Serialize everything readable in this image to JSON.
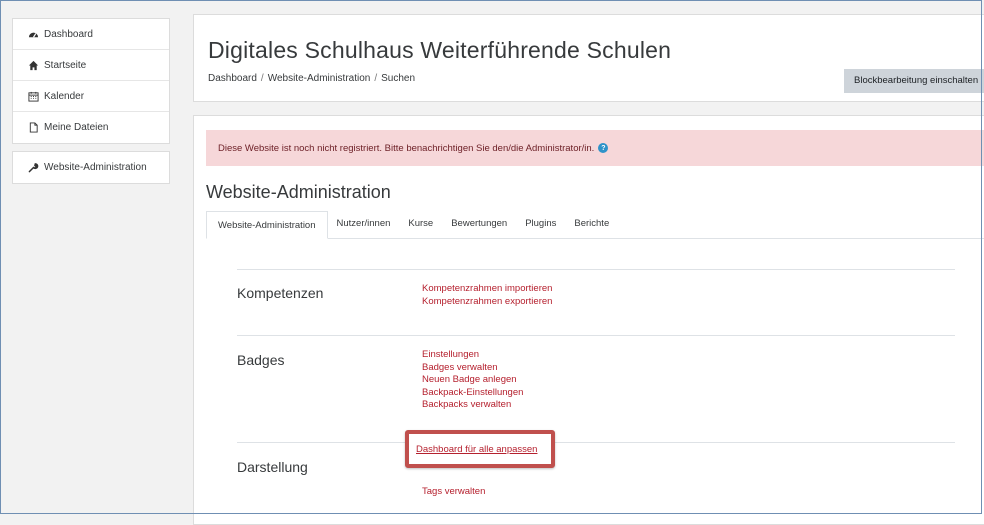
{
  "sidebar": {
    "items": [
      {
        "label": "Dashboard",
        "icon": "tachometer-icon"
      },
      {
        "label": "Startseite",
        "icon": "home-icon"
      },
      {
        "label": "Kalender",
        "icon": "calendar-icon"
      },
      {
        "label": "Meine Dateien",
        "icon": "file-icon"
      }
    ],
    "admin_item": {
      "label": "Website-Administration",
      "icon": "wrench-icon"
    }
  },
  "header": {
    "title": "Digitales Schulhaus Weiterführende Schulen",
    "breadcrumb": [
      "Dashboard",
      "Website-Administration",
      "Suchen"
    ],
    "breadcrumb_separator": "/",
    "edit_button": "Blockbearbeitung einschalten"
  },
  "alert": {
    "text": "Diese Website ist noch nicht registriert. Bitte benachrichtigen Sie den/die Administrator/in.",
    "help_glyph": "?"
  },
  "main": {
    "heading": "Website-Administration",
    "tabs": [
      "Website-Administration",
      "Nutzer/innen",
      "Kurse",
      "Bewertungen",
      "Plugins",
      "Berichte"
    ],
    "sections": [
      {
        "title": "Kompetenzen",
        "links": [
          "Kompetenzrahmen importieren",
          "Kompetenzrahmen exportieren"
        ]
      },
      {
        "title": "Badges",
        "links": [
          "Einstellungen",
          "Badges verwalten",
          "Neuen Badge anlegen",
          "Backpack-Einstellungen",
          "Backpacks verwalten"
        ]
      },
      {
        "title": "Darstellung",
        "links": [
          "Tags verwalten"
        ]
      }
    ],
    "highlighted_link": "Dashboard für alle anpassen"
  },
  "colors": {
    "link": "#b5202e",
    "alert_bg": "#f6d7d9",
    "highlight_border": "#c0504d"
  }
}
